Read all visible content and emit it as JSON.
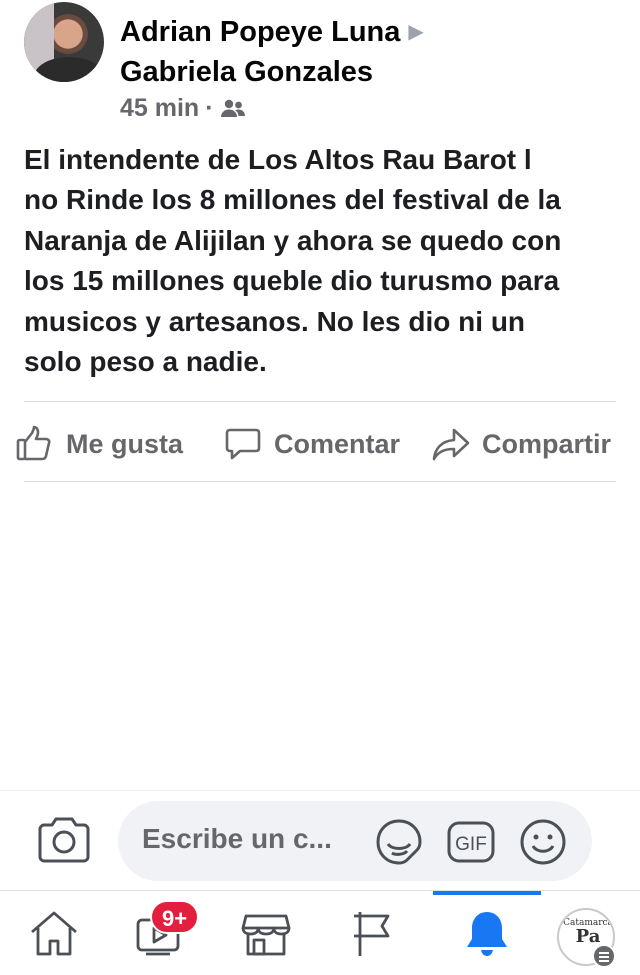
{
  "post": {
    "author": "Adrian Popeye Luna",
    "arrow": "▶",
    "recipient": "Gabriela Gonzales",
    "time": "45 min",
    "separator": "·",
    "audience_icon": "friends-icon",
    "text": "El intendente de Los Altos  Rau Barot l\nno Rinde los 8 millones del festival de la\nNaranja de Alijilan y ahora se quedo con\nlos 15 millones queble dio turusmo para\nmusicos y artesanos. No les dio ni un\nsolo peso a nadie."
  },
  "actions": {
    "like_label": "Me gusta",
    "comment_label": "Comentar",
    "share_label": "Compartir"
  },
  "composer": {
    "placeholder": "Escribe un c...",
    "icons": [
      "camera-icon",
      "sticker-icon",
      "gif-icon",
      "emoji-icon"
    ],
    "gif_label": "GIF"
  },
  "tabbar": {
    "items": [
      "home-icon",
      "video-icon",
      "marketplace-icon",
      "pages-icon",
      "notifications-icon",
      "profile-menu"
    ],
    "video_badge": "9+",
    "profile_text_top": "Catamarca",
    "profile_text_main": "Pa",
    "active": "notifications-icon",
    "accent": "#1877f2"
  }
}
